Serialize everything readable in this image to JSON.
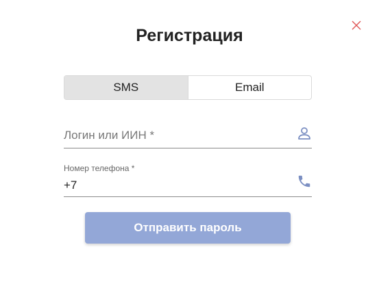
{
  "dialog": {
    "title": "Регистрация",
    "close_icon": "close-icon"
  },
  "tabs": [
    {
      "label": "SMS",
      "active": true
    },
    {
      "label": "Email",
      "active": false
    }
  ],
  "login_field": {
    "placeholder": "Логин или ИИН *",
    "value": "",
    "icon": "user-icon"
  },
  "phone_field": {
    "label": "Номер телефона *",
    "value": "+7",
    "icon": "phone-icon"
  },
  "submit_button": {
    "label": "Отправить пароль"
  },
  "colors": {
    "accent": "#93a7d7",
    "icon": "#7b8fc2",
    "close": "#e05555",
    "tab_active_bg": "#e3e3e3"
  }
}
